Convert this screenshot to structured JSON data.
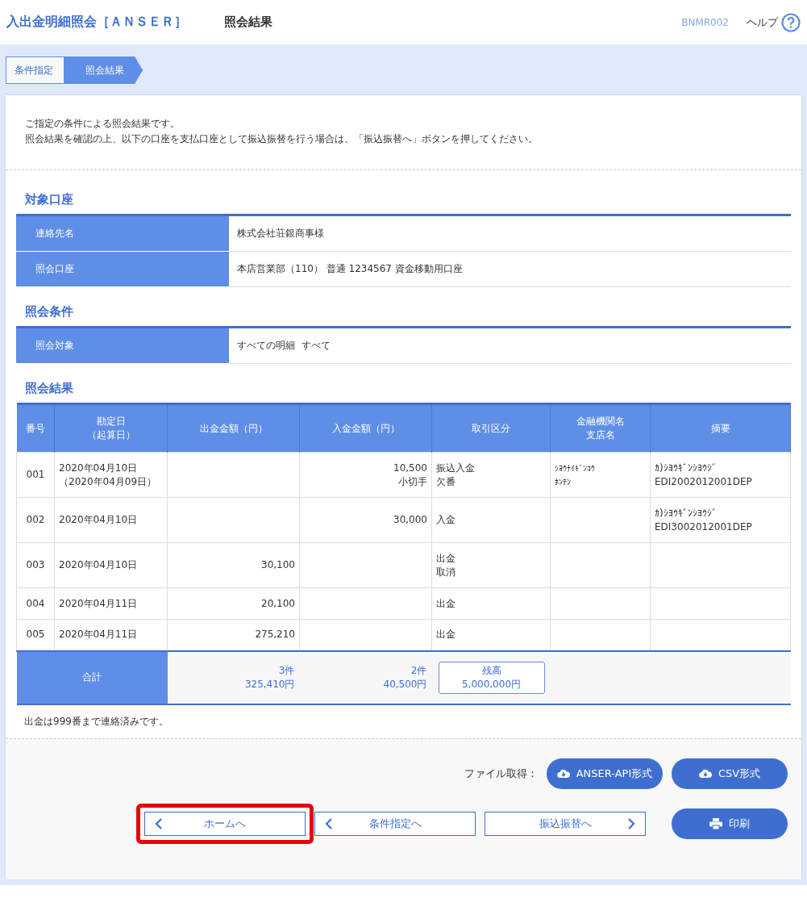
{
  "header": {
    "title": "入出金明細照会［ＡＮＳＥＲ］",
    "subtitle": "照会結果",
    "screen_id": "BNMR002",
    "help": "ヘルプ"
  },
  "steps": [
    {
      "label": "条件指定",
      "selected": false
    },
    {
      "label": "照会結果",
      "selected": true
    }
  ],
  "intro": [
    "ご指定の条件による照会結果です。",
    "照会結果を確認の上、以下の口座を支払口座として振込振替を行う場合は、「振込振替へ」ボタンを押してください。"
  ],
  "account_section": {
    "title": "対象口座",
    "rows": [
      {
        "label": "連絡先名",
        "value": "株式会社荘銀商事様"
      },
      {
        "label": "照会口座",
        "value": "本店営業部（110） 普通 1234567 資金移動用口座"
      }
    ]
  },
  "condition_section": {
    "title": "照会条件",
    "rows": [
      {
        "label": "照会対象",
        "value": "すべての明細  すべて"
      }
    ]
  },
  "result_section": {
    "title": "照会結果",
    "columns": [
      [
        "番号"
      ],
      [
        "勘定日",
        "（起算日）"
      ],
      [
        "出金金額（円）"
      ],
      [
        "入金金額（円）"
      ],
      [
        "取引区分"
      ],
      [
        "金融機関名",
        "支店名"
      ],
      [
        "摘要"
      ]
    ],
    "rows": [
      {
        "no": [
          "001"
        ],
        "date": [
          "2020年04月10日",
          "（2020年04月09日）"
        ],
        "withdrawal": [],
        "deposit": [
          "10,500",
          "小切手"
        ],
        "type": [
          "振込入金",
          "欠番"
        ],
        "bank": [
          "ｼﾖｳﾅｲｷﾞﾝｺｳ",
          "ﾎﾝﾃﾝ"
        ],
        "memo": [
          "ｶ)ｼﾖｳｷﾞﾝｼﾖｳｼﾞ",
          "EDI2002012001DEP"
        ]
      },
      {
        "no": [
          "002"
        ],
        "date": [
          "2020年04月10日"
        ],
        "withdrawal": [],
        "deposit": [
          "30,000"
        ],
        "type": [
          "入金"
        ],
        "bank": [],
        "memo": [
          "ｶ)ｼﾖｳｷﾞﾝｼﾖｳｼﾞ",
          "EDI3002012001DEP"
        ]
      },
      {
        "no": [
          "003"
        ],
        "date": [
          "2020年04月10日"
        ],
        "withdrawal": [
          "30,100"
        ],
        "deposit": [],
        "type": [
          "出金",
          "取消"
        ],
        "bank": [],
        "memo": []
      },
      {
        "no": [
          "004"
        ],
        "date": [
          "2020年04月11日"
        ],
        "withdrawal": [
          "20,100"
        ],
        "deposit": [],
        "type": [
          "出金"
        ],
        "bank": [],
        "memo": []
      },
      {
        "no": [
          "005"
        ],
        "date": [
          "2020年04月11日"
        ],
        "withdrawal": [
          "275,210"
        ],
        "deposit": [],
        "type": [
          "出金"
        ],
        "bank": [],
        "memo": []
      }
    ],
    "total": {
      "label": "合計",
      "withdrawal": [
        "3件",
        "325,410円"
      ],
      "deposit": [
        "2件",
        "40,500円"
      ],
      "balance": [
        "残高",
        "5,000,000円"
      ]
    },
    "note": "出金は999番まで連絡済みです。"
  },
  "file_label": "ファイル取得：",
  "file_buttons": [
    "ANSER-API形式",
    "CSV形式"
  ],
  "nav_buttons": [
    {
      "label": "ホームへ",
      "kind": "back",
      "highlighted": true
    },
    {
      "label": "条件指定へ",
      "kind": "back",
      "highlighted": false
    },
    {
      "label": "振込振替へ",
      "kind": "forward",
      "highlighted": false
    }
  ],
  "print_button": "印刷"
}
